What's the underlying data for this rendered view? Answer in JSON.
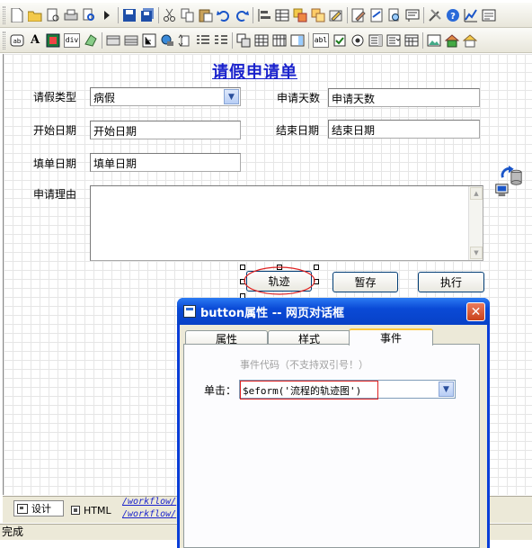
{
  "form": {
    "title": "请假申请单",
    "fields": {
      "leave_type_label": "请假类型",
      "leave_type_value": "病假",
      "days_label": "申请天数",
      "days_value": "申请天数",
      "start_date_label": "开始日期",
      "start_date_value": "开始日期",
      "end_date_label": "结束日期",
      "end_date_value": "结束日期",
      "fill_date_label": "填单日期",
      "fill_date_value": "填单日期",
      "reason_label": "申请理由"
    },
    "buttons": {
      "track": "轨迹",
      "save_draft": "暂存",
      "execute": "执行"
    }
  },
  "bottom": {
    "design_tab": "设计",
    "html_tab": "HTML",
    "path_line1": "/workflow/",
    "path_line2": "/workflow/"
  },
  "status": {
    "text": "完成"
  },
  "dialog": {
    "title": "button属性 -- 网页对话框",
    "tabs": [
      "属性",
      "样式",
      "事件"
    ],
    "active_tab": "事件",
    "hint": "事件代码（不支持双引号！）",
    "click_label": "单击：",
    "click_value": "$eform('流程的轨迹图')"
  },
  "colors": {
    "form_title": "#1a22cc",
    "dialog_title_bar": "#0a4ad6",
    "highlight_border": "#dd2222"
  },
  "icons": {
    "toolbar1": [
      "new-doc-icon",
      "open-folder-icon",
      "print-preview-icon",
      "print-icon",
      "find-icon",
      "run-icon",
      "save-icon",
      "save-all-icon",
      "cut-icon",
      "copy-icon",
      "paste-icon",
      "undo-icon",
      "redo-icon",
      "align-icon",
      "table-icon",
      "layer-icon",
      "properties-icon",
      "edit-icon",
      "edit-form-icon",
      "page-icon",
      "preview-icon",
      "tools-icon",
      "help-icon",
      "chart-icon",
      "list-icon"
    ],
    "toolbar2": [
      "textbox-icon",
      "label-icon",
      "image-icon",
      "div-icon",
      "shape-icon",
      "panel-icon",
      "grid-icon",
      "tree-icon",
      "globe-icon",
      "spinner-icon",
      "list-control-icon",
      "split-icon",
      "table-control-icon",
      "datagrid-icon",
      "tabs-icon",
      "text-input-icon",
      "checkbox-icon",
      "radio-icon",
      "listbox-icon",
      "combo-control-icon",
      "calendar-icon",
      "picture-icon",
      "home-icon",
      "nav-icon"
    ]
  }
}
